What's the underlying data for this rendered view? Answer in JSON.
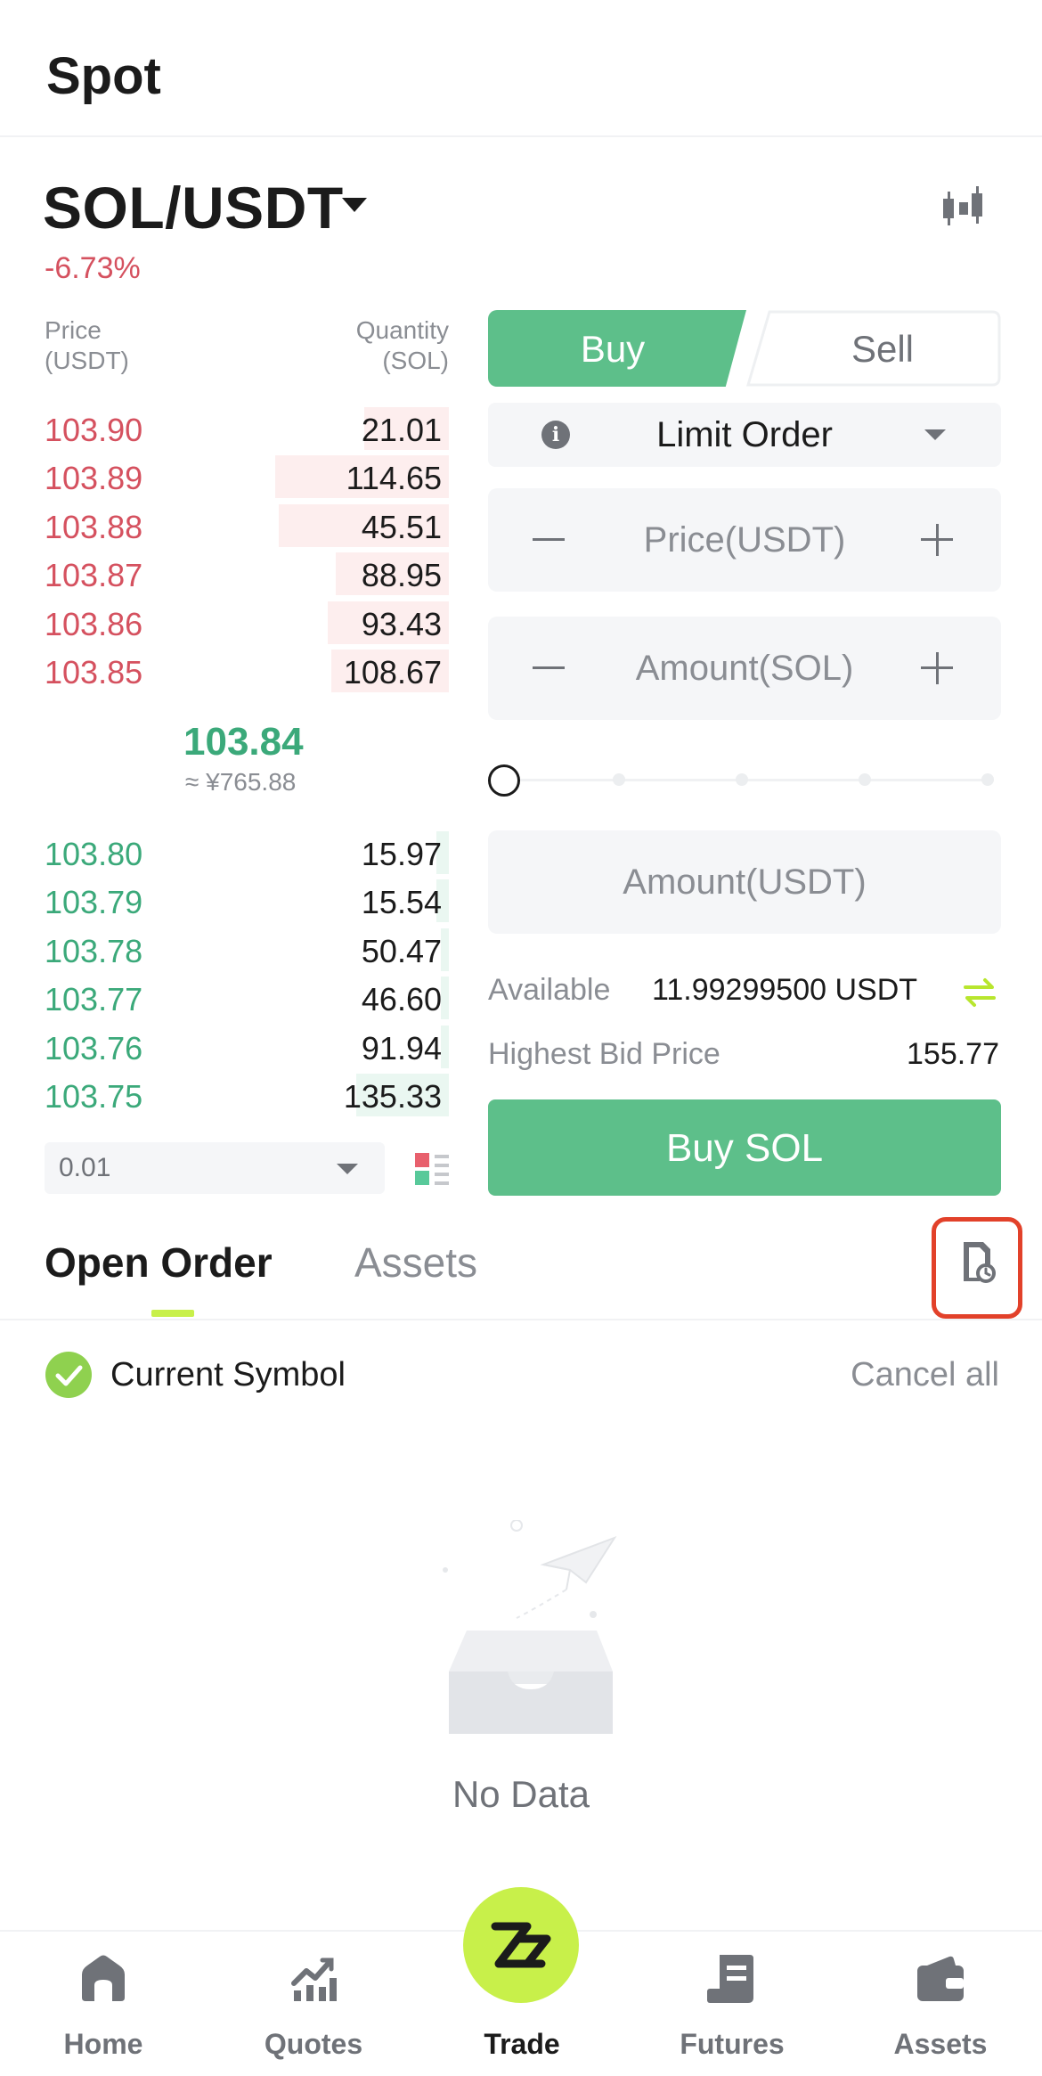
{
  "header": {
    "title": "Spot"
  },
  "pair": {
    "symbol": "SOL/USDT",
    "change": "-6.73%"
  },
  "orderbook": {
    "price_header": "Price\n(USDT)",
    "qty_header": "Quantity\n(SOL)",
    "asks": [
      {
        "price": "103.90",
        "qty": "21.01",
        "depth": 0.21
      },
      {
        "price": "103.89",
        "qty": "114.65",
        "depth": 0.43
      },
      {
        "price": "103.88",
        "qty": "45.51",
        "depth": 0.42
      },
      {
        "price": "103.87",
        "qty": "88.95",
        "depth": 0.28
      },
      {
        "price": "103.86",
        "qty": "93.43",
        "depth": 0.3
      },
      {
        "price": "103.85",
        "qty": "108.67",
        "depth": 0.29
      }
    ],
    "last_price": "103.84",
    "last_fiat": "≈ ¥765.88",
    "bids": [
      {
        "price": "103.80",
        "qty": "15.97",
        "depth": 0.03
      },
      {
        "price": "103.79",
        "qty": "15.54",
        "depth": 0.03
      },
      {
        "price": "103.78",
        "qty": "50.47",
        "depth": 0.02
      },
      {
        "price": "103.77",
        "qty": "46.60",
        "depth": 0.02
      },
      {
        "price": "103.76",
        "qty": "91.94",
        "depth": 0.02
      },
      {
        "price": "103.75",
        "qty": "135.33",
        "depth": 0.23
      }
    ],
    "precision": "0.01"
  },
  "trade": {
    "buy_tab": "Buy",
    "sell_tab": "Sell",
    "order_type": "Limit Order",
    "price_placeholder": "Price(USDT)",
    "amount_placeholder": "Amount(SOL)",
    "total_placeholder": "Amount(USDT)",
    "slider_percent": 0,
    "available_label": "Available",
    "available_value": "11.99299500 USDT",
    "highest_bid_label": "Highest Bid Price",
    "highest_bid_value": "155.77",
    "buy_button": "Buy SOL"
  },
  "orders": {
    "tab_open": "Open Order",
    "tab_assets": "Assets",
    "current_symbol": "Current Symbol",
    "cancel_all": "Cancel all",
    "empty": "No Data"
  },
  "nav": {
    "items": [
      {
        "label": "Home",
        "icon": "home-icon"
      },
      {
        "label": "Quotes",
        "icon": "quotes-icon"
      },
      {
        "label": "Trade",
        "icon": "trade-logo-icon"
      },
      {
        "label": "Futures",
        "icon": "futures-icon"
      },
      {
        "label": "Assets",
        "icon": "wallet-icon"
      }
    ]
  },
  "colors": {
    "buy_green": "#5dbf8a",
    "ask_red": "#d5515f",
    "bid_green": "#3ba97a",
    "accent_lime": "#c8f04a",
    "highlight_red": "#e2412a"
  }
}
